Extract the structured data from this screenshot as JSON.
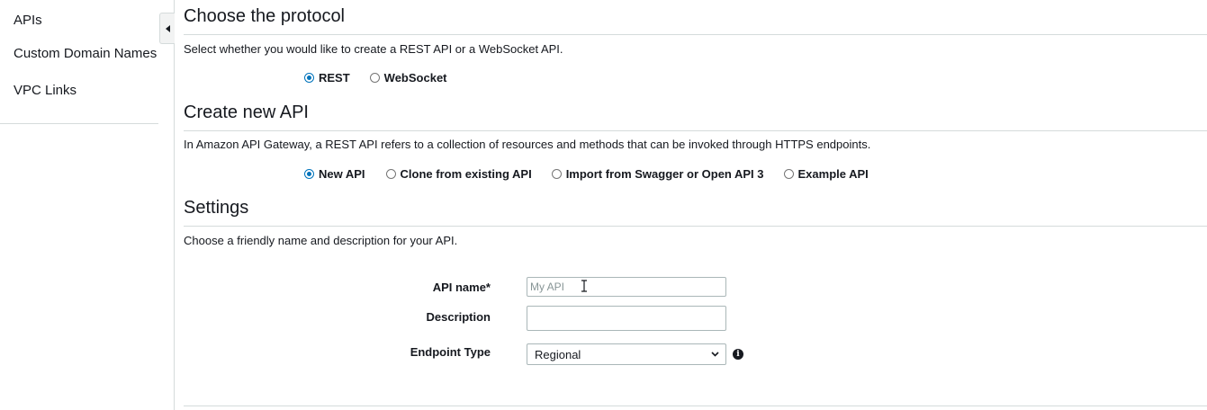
{
  "sidebar": {
    "items": [
      {
        "label": "APIs"
      },
      {
        "label": "Custom Domain Names"
      },
      {
        "label": "VPC Links"
      }
    ],
    "collapse_icon": "triangle-left-icon"
  },
  "protocol": {
    "title": "Choose the protocol",
    "description": "Select whether you would like to create a REST API or a WebSocket API.",
    "options": [
      {
        "label": "REST",
        "selected": true
      },
      {
        "label": "WebSocket",
        "selected": false
      }
    ]
  },
  "create_api": {
    "title": "Create new API",
    "description": "In Amazon API Gateway, a REST API refers to a collection of resources and methods that can be invoked through HTTPS endpoints.",
    "options": [
      {
        "label": "New API",
        "selected": true
      },
      {
        "label": "Clone from existing API",
        "selected": false
      },
      {
        "label": "Import from Swagger or Open API 3",
        "selected": false
      },
      {
        "label": "Example API",
        "selected": false
      }
    ]
  },
  "settings": {
    "title": "Settings",
    "description": "Choose a friendly name and description for your API.",
    "api_name": {
      "label": "API name*",
      "value": "",
      "placeholder": "My API"
    },
    "description_field": {
      "label": "Description",
      "value": ""
    },
    "endpoint_type": {
      "label": "Endpoint Type",
      "selected": "Regional",
      "info_icon": "info-icon"
    }
  },
  "colors": {
    "accent": "#0073bb",
    "border": "#d5dbdb",
    "text": "#16191f"
  }
}
